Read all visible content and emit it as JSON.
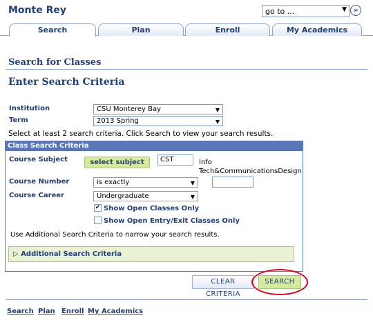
{
  "header": {
    "brand": "Monte Rey",
    "goto_value": "go to ..."
  },
  "tabs": [
    {
      "label": "Search",
      "active": true
    },
    {
      "label": "Plan",
      "active": false
    },
    {
      "label": "Enroll",
      "active": false
    },
    {
      "label": "My Academics",
      "active": false
    }
  ],
  "page": {
    "section_title": "Search for Classes",
    "subtitle": "Enter Search Criteria",
    "hint": "Select at least 2 search criteria. Click Search to view your search results."
  },
  "form": {
    "institution_label": "Institution",
    "institution_value": "CSU Monterey Bay",
    "term_label": "Term",
    "term_value": "2013 Spring"
  },
  "criteria": {
    "header": "Class Search Criteria",
    "subject_label": "Course Subject",
    "select_subject_button": "select subject",
    "subject_value": "CST",
    "subject_desc_line1": "Info",
    "subject_desc_line2": "Tech&CommunicationsDesign",
    "number_label": "Course Number",
    "number_operator": "is exactly",
    "number_value": "",
    "career_label": "Course Career",
    "career_value": "Undergraduate",
    "open_classes_label": "Show Open Classes Only",
    "open_classes_checked": true,
    "open_entry_label": "Show Open Entry/Exit Classes Only",
    "open_entry_checked": false,
    "additional_hint": "Use Additional Search Criteria to narrow your search results.",
    "additional_toggle": "Additional Search Criteria"
  },
  "actions": {
    "clear": "CLEAR CRITERIA",
    "search": "SEARCH"
  },
  "footer": {
    "links": [
      "Search",
      "Plan",
      "Enroll",
      "My Academics"
    ]
  },
  "colors": {
    "accent": "#1f3f7a",
    "panel_header": "#5a76b6",
    "highlight_ring": "#e0001b",
    "green_button": "#d6ea9c"
  }
}
